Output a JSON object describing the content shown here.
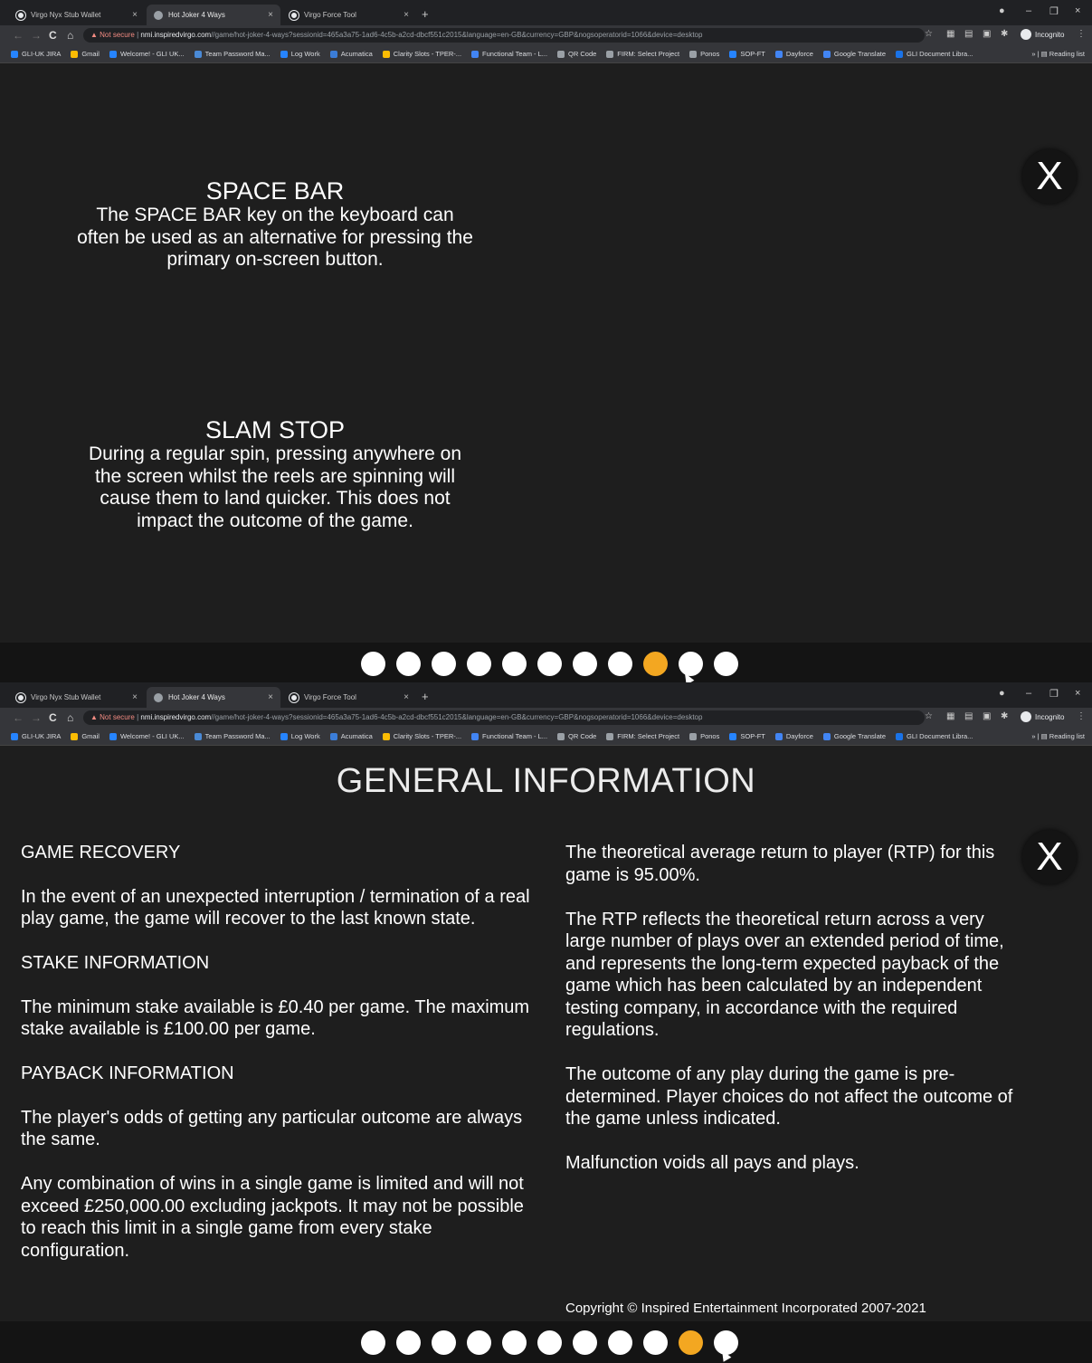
{
  "browser": {
    "tabs": [
      {
        "label": "Virgo Nyx Stub Wallet",
        "close": "×"
      },
      {
        "label": "Hot Joker 4 Ways",
        "close": "×"
      },
      {
        "label": "Virgo Force Tool",
        "close": "×"
      }
    ],
    "new_tab": "+",
    "window_controls": {
      "minimize": "–",
      "restore": "❐",
      "close": "×"
    },
    "nav": {
      "back": "←",
      "forward": "→",
      "reload": "C",
      "home": "⌂"
    },
    "address": {
      "security": "Not secure",
      "host": "nmi.inspiredvirgo.com",
      "path": "//game/hot-joker-4-ways?sessionid=465a3a75-1ad6-4c5b-a2cd-dbcf551c2015&language=en-GB&currency=GBP&nogsoperatorid=1066&device=desktop"
    },
    "profile": "Incognito",
    "bookmarks": [
      {
        "label": "GLI-UK JIRA",
        "color": "#2684ff"
      },
      {
        "label": "Gmail",
        "color": "#fbbc04"
      },
      {
        "label": "Welcome! - GLI UK...",
        "color": "#2684ff"
      },
      {
        "label": "Team Password Ma...",
        "color": "#4a8ad6"
      },
      {
        "label": "Log Work",
        "color": "#2684ff"
      },
      {
        "label": "Acumatica",
        "color": "#3b7dd8"
      },
      {
        "label": "Clarity Slots - TPER-...",
        "color": "#fbbc04"
      },
      {
        "label": "Functional Team - L...",
        "color": "#4285f4"
      },
      {
        "label": "QR Code",
        "color": "#9aa0a6"
      },
      {
        "label": "FIRM: Select Project",
        "color": "#9aa0a6"
      },
      {
        "label": "Ponos",
        "color": "#9aa0a6"
      },
      {
        "label": "SOP-FT",
        "color": "#2684ff"
      },
      {
        "label": "Dayforce",
        "color": "#4285f4"
      },
      {
        "label": "Google Translate",
        "color": "#4285f4"
      },
      {
        "label": "GLI Document Libra...",
        "color": "#1a73e8"
      }
    ],
    "bookmarks_more": "»",
    "reading_list": "Reading list"
  },
  "screen1": {
    "close_label": "X",
    "space_bar": {
      "title": "SPACE BAR",
      "body": "The SPACE BAR key on the keyboard can often be used as an alternative for pressing the primary on-screen button."
    },
    "slam_stop": {
      "title": "SLAM STOP",
      "body": "During a regular spin, pressing anywhere on the screen whilst the reels are spinning will cause them to land quicker. This does not impact the outcome of the game."
    },
    "pagination": {
      "total": 11,
      "active_index": 8
    }
  },
  "screen2": {
    "close_label": "X",
    "title": "GENERAL INFORMATION",
    "left": {
      "game_recovery_title": "GAME RECOVERY",
      "game_recovery_body": "In the event of an unexpected interruption / termination of a real play game, the game will recover to the last known state.",
      "stake_title": "STAKE INFORMATION",
      "stake_body": "The minimum stake available is £0.40 per game. The maximum stake available is £100.00 per game.",
      "payback_title": "PAYBACK INFORMATION",
      "payback_body_1": "The player's odds of getting any particular outcome are always the same.",
      "payback_body_2": "Any combination of wins in a single game is limited and will not exceed £250,000.00 excluding jackpots. It may not be possible to reach this limit in a single game from every stake configuration."
    },
    "right": {
      "rtp": "The theoretical average return to player (RTP) for this game is 95.00%.",
      "rtp_detail": "The RTP reflects the theoretical return across a very large number of plays over an extended period of time, and represents the long-term expected payback of the game which has been calculated by an independent testing company, in accordance with the required regulations.",
      "outcome": "The outcome of any play during the game is pre-determined. Player choices do not affect the outcome of the game unless indicated.",
      "malfunction": "Malfunction voids all pays and plays."
    },
    "copyright": "Copyright © Inspired Entertainment Incorporated 2007-2021",
    "pagination": {
      "total": 11,
      "active_index": 9
    }
  }
}
